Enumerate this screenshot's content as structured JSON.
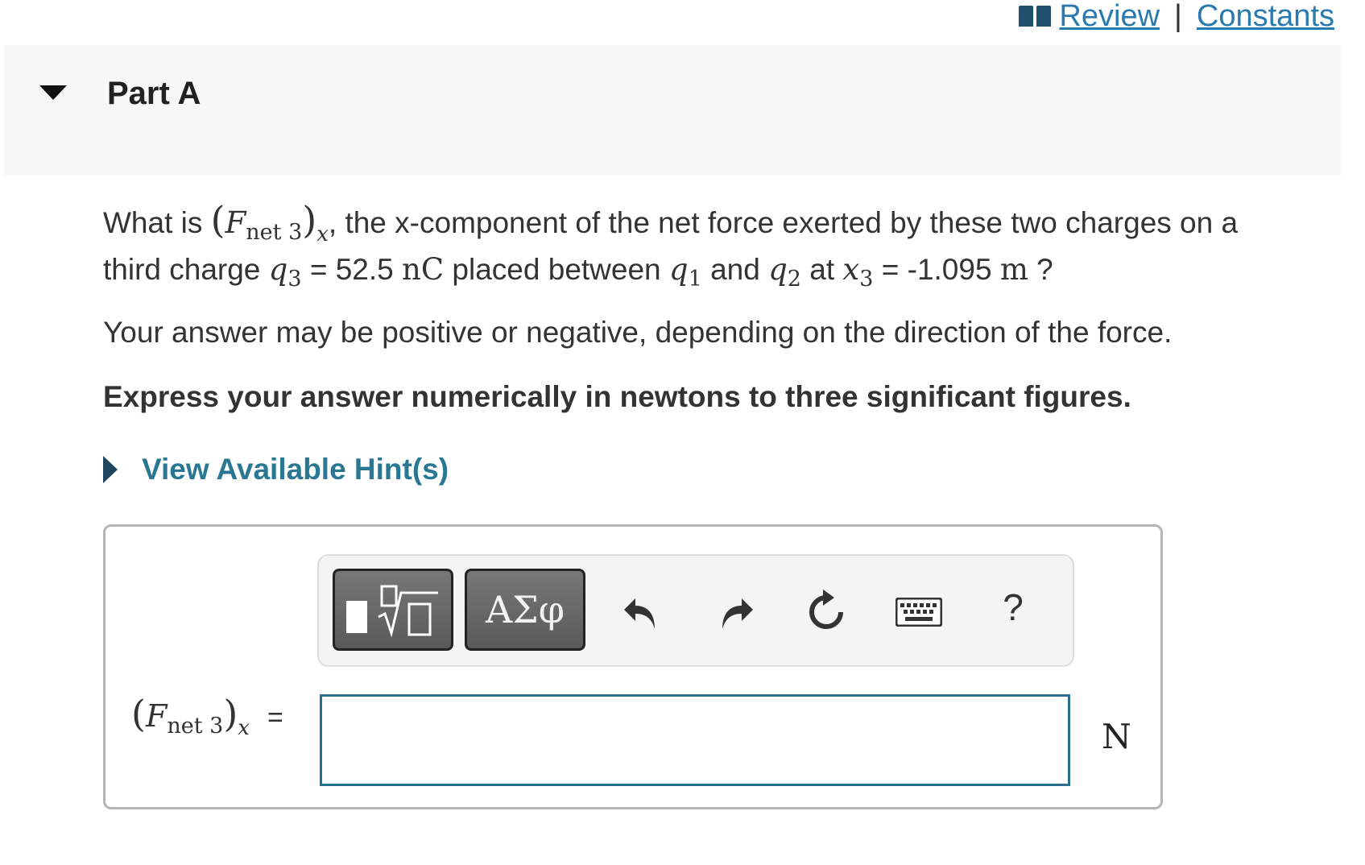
{
  "header": {
    "review_label": "Review",
    "separator": "|",
    "constants_label": "Constants"
  },
  "part": {
    "title": "Part A"
  },
  "question": {
    "line1_prefix": "What is ",
    "symbol_F": "F",
    "symbol_net3": "net 3",
    "symbol_x": "x",
    "line1_suffix": ", the x-component of the net force exerted by these two charges on a",
    "line2_prefix": "third charge ",
    "q3_symbol": "q",
    "q3_sub": "3",
    "q3_value": " = 52.5 ",
    "q3_unit": "nC",
    "mid_text": " placed between ",
    "q1_symbol": "q",
    "q1_sub": "1",
    "and_text": " and ",
    "q2_symbol": "q",
    "q2_sub": "2",
    "at_text": " at ",
    "x3_symbol": "x",
    "x3_sub": "3",
    "x3_value": " = -1.095 ",
    "x3_unit": "m",
    "end_text": " ?"
  },
  "note": "Your answer may be positive or negative, depending on the direction of the force.",
  "instruction": "Express your answer numerically in newtons to three significant figures.",
  "hint_label": "View Available Hint(s)",
  "toolbar": {
    "greek_label": "ΑΣφ",
    "help_label": "?"
  },
  "answer": {
    "label_F": "F",
    "label_net3": "net 3",
    "label_x": "x",
    "equals": "=",
    "value": "",
    "unit": "N"
  },
  "colors": {
    "link": "#2a7ab0",
    "hint": "#2a7794",
    "input_border": "#2b6f90",
    "toolbar_button": "#666666",
    "part_header_bg": "#f7f7f7"
  },
  "icons": [
    "book-icon",
    "caret-down-icon",
    "caret-right-icon",
    "templates-icon",
    "undo-icon",
    "redo-icon",
    "reset-icon",
    "keyboard-icon"
  ]
}
